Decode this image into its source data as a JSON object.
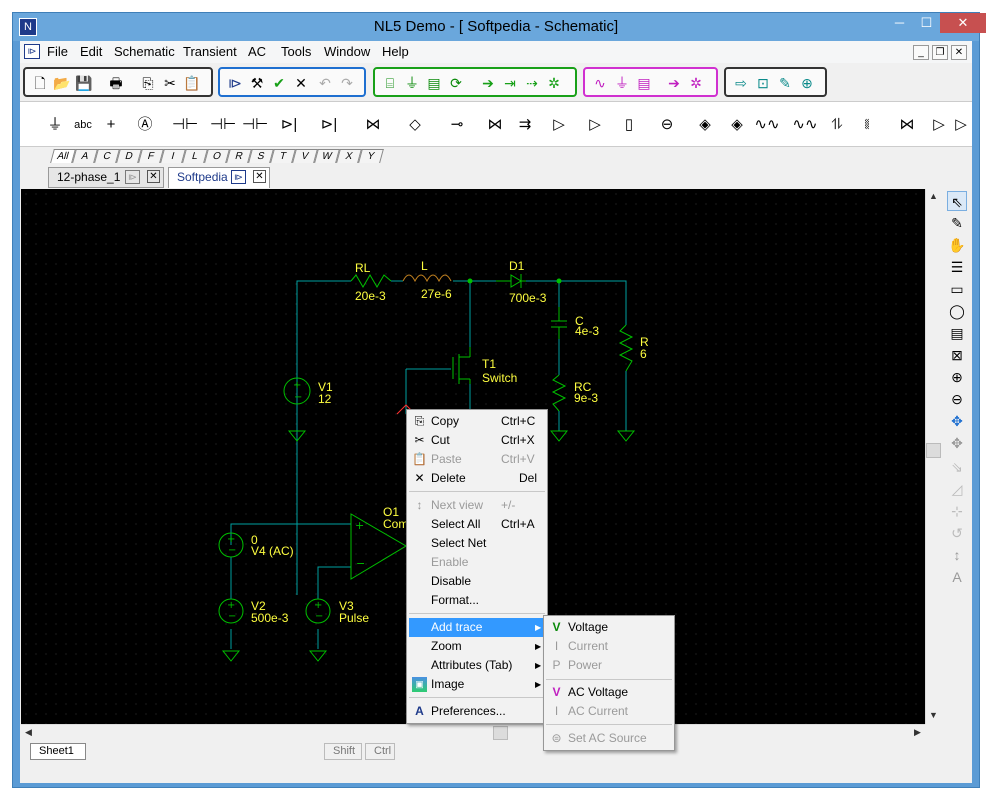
{
  "window": {
    "title": "NL5 Demo - [ Softpedia - Schematic]",
    "controls": {
      "minimize": "─",
      "maximize": "☐",
      "close": "✕"
    }
  },
  "menubar": {
    "items": [
      "File",
      "Edit",
      "Schematic",
      "Transient",
      "AC",
      "Tools",
      "Window",
      "Help"
    ],
    "mdi_controls": {
      "minimize": "_",
      "restore": "❐",
      "close": "✕"
    }
  },
  "palette": {
    "letter_tabs": [
      "All",
      "A",
      "C",
      "D",
      "F",
      "I",
      "L",
      "O",
      "R",
      "S",
      "T",
      "V",
      "W",
      "X",
      "Y"
    ]
  },
  "document_tabs": [
    {
      "label": "12-phase_1",
      "active": false
    },
    {
      "label": "Softpedia",
      "active": true
    }
  ],
  "schematic": {
    "labels": {
      "rl_name": "RL",
      "rl_value": "20e-3",
      "l_name": "L",
      "l_value": "27e-6",
      "d1_name": "D1",
      "d1_value": "700e-3",
      "c_name": "C",
      "c_value": "4e-3",
      "r_name": "R",
      "r_value": "6",
      "t1_name": "T1",
      "t1_value": "Switch",
      "rc_name": "RC",
      "rc_value": "9e-3",
      "v1_name": "V1",
      "v1_value": "12",
      "o1_name": "O1",
      "o1_value": "Com",
      "v4_name": "0",
      "v4_value": "V4 (AC)",
      "v2_name": "V2",
      "v2_value": "500e-3",
      "v3_name": "V3",
      "v3_value": "Pulse"
    },
    "colors": {
      "wire": "#00a0a0",
      "label": "#ffff40",
      "background": "#000000",
      "ground": "#00a000"
    }
  },
  "context_menu": {
    "items": [
      {
        "label": "Copy",
        "shortcut": "Ctrl+C",
        "enabled": true,
        "icon": "copy-icon"
      },
      {
        "label": "Cut",
        "shortcut": "Ctrl+X",
        "enabled": true,
        "icon": "cut-icon"
      },
      {
        "label": "Paste",
        "shortcut": "Ctrl+V",
        "enabled": false,
        "icon": "paste-icon"
      },
      {
        "label": "Delete",
        "shortcut": "Del",
        "enabled": true,
        "icon": "delete-icon"
      },
      {
        "label": "Next view",
        "shortcut": "+/-",
        "enabled": false,
        "icon": "next-view-icon"
      },
      {
        "label": "Select All",
        "shortcut": "Ctrl+A",
        "enabled": true
      },
      {
        "label": "Select Net",
        "shortcut": "",
        "enabled": true
      },
      {
        "label": "Enable",
        "shortcut": "",
        "enabled": false
      },
      {
        "label": "Disable",
        "shortcut": "",
        "enabled": true
      },
      {
        "label": "Format...",
        "shortcut": "",
        "enabled": true
      },
      {
        "label": "Add trace",
        "shortcut": "",
        "enabled": true,
        "submenu": true,
        "highlighted": true
      },
      {
        "label": "Zoom",
        "shortcut": "",
        "enabled": true,
        "submenu": true
      },
      {
        "label": "Attributes (Tab)",
        "shortcut": "",
        "enabled": true,
        "submenu": true
      },
      {
        "label": "Image",
        "shortcut": "",
        "enabled": true,
        "submenu": true,
        "icon": "image-icon"
      },
      {
        "label": "Preferences...",
        "shortcut": "",
        "enabled": true,
        "icon": "preferences-icon"
      }
    ]
  },
  "submenu": {
    "items": [
      {
        "label": "Voltage",
        "enabled": true,
        "icon": "voltage-trace-icon"
      },
      {
        "label": "Current",
        "enabled": false,
        "icon": "current-trace-icon"
      },
      {
        "label": "Power",
        "enabled": false,
        "icon": "power-trace-icon"
      },
      {
        "label": "AC Voltage",
        "enabled": true,
        "icon": "ac-voltage-icon"
      },
      {
        "label": "AC Current",
        "enabled": false,
        "icon": "ac-current-icon"
      },
      {
        "label": "Set AC Source",
        "enabled": false,
        "icon": "ac-source-icon"
      }
    ]
  },
  "statusbar": {
    "sheet_tab": "Sheet1",
    "shift": "Shift",
    "ctrl": "Ctrl"
  }
}
